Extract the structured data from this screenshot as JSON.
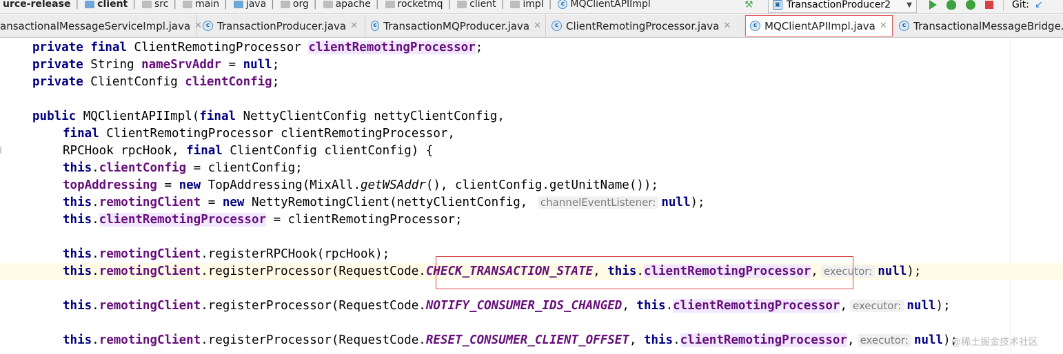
{
  "breadcrumb": {
    "items": [
      {
        "label": "urce-release",
        "icon": "none",
        "bold": true
      },
      {
        "label": "client",
        "icon": "module-folder-icon",
        "bold": true
      },
      {
        "label": "src",
        "icon": "folder-icon"
      },
      {
        "label": "main",
        "icon": "folder-icon"
      },
      {
        "label": "java",
        "icon": "source-folder-icon"
      },
      {
        "label": "org",
        "icon": "package-icon"
      },
      {
        "label": "apache",
        "icon": "package-icon"
      },
      {
        "label": "rocketmq",
        "icon": "package-icon"
      },
      {
        "label": "client",
        "icon": "package-icon"
      },
      {
        "label": "impl",
        "icon": "package-icon"
      },
      {
        "label": "MQClientAPIImpl",
        "icon": "class-icon"
      }
    ]
  },
  "toolbar": {
    "run_config": "TransactionProducer2",
    "git_label": "Git:"
  },
  "tabs": [
    {
      "label": "ansactionalMessageServiceImpl.java",
      "active": false
    },
    {
      "label": "TransactionProducer.java",
      "active": false
    },
    {
      "label": "TransactionMQProducer.java",
      "active": false
    },
    {
      "label": "ClientRemotingProcessor.java",
      "active": false
    },
    {
      "label": "MQClientAPIImpl.java",
      "active": true
    },
    {
      "label": "TransactionalMessageBridge.java",
      "active": false
    }
  ],
  "code": {
    "l1": {
      "kw1": "private",
      "kw2": "final",
      "type": " ClientRemotingProcessor ",
      "field": "clientRemotingProcessor",
      "end": ";"
    },
    "l2": {
      "kw1": "private",
      "type": " String ",
      "field": "nameSrvAddr",
      "eq": " = ",
      "nul": "null",
      "end": ";"
    },
    "l3": {
      "kw1": "private",
      "type": " ClientConfig ",
      "field": "clientConfig",
      "end": ";"
    },
    "l5": {
      "kw1": "public",
      "sig": " MQClientAPIImpl(",
      "kw2": "final",
      "rest": " NettyClientConfig nettyClientConfig,"
    },
    "l6": {
      "kw1": "final",
      "rest": " ClientRemotingProcessor clientRemotingProcessor,"
    },
    "l7": {
      "pre": "RPCHook rpcHook, ",
      "kw1": "final",
      "rest": " ClientConfig clientConfig) {"
    },
    "l8": {
      "kw": "this",
      "dot": ".",
      "field": "clientConfig",
      "rest": " = clientConfig;"
    },
    "l9": {
      "field": "topAddressing",
      "eq": " = ",
      "kw": "new",
      "mid": " TopAddressing(MixAll.",
      "method": "getWSAddr",
      "rest": "(), clientConfig.getUnitName());"
    },
    "l10": {
      "kw": "this",
      "dot": ".",
      "field": "remotingClient",
      "eq": " = ",
      "kw2": "new",
      "mid": " NettyRemotingClient(nettyClientConfig, ",
      "hint": "channelEventListener:",
      "nul": "null",
      "end": ");"
    },
    "l11": {
      "kw": "this",
      "dot": ".",
      "field": "clientRemotingProcessor",
      "rest": " = clientRemotingProcessor;"
    },
    "l13": {
      "kw": "this",
      "dot": ".",
      "field": "remotingClient",
      "rest": ".registerRPCHook(rpcHook);"
    },
    "l14": {
      "kw": "this",
      "dot": ".",
      "field": "remotingClient",
      "mid": ".registerProcessor(RequestCode.",
      "const": "CHECK_TRANSACTION_STATE",
      "comma": ", ",
      "kw2": "this",
      "dot2": ".",
      "field2": "clientRemotingProcessor",
      "comma2": ",",
      "hint": "executor:",
      "nul": "null",
      "end": ");"
    },
    "l16": {
      "kw": "this",
      "dot": ".",
      "field": "remotingClient",
      "mid": ".registerProcessor(RequestCode.",
      "const": "NOTIFY_CONSUMER_IDS_CHANGED",
      "comma": ", ",
      "kw2": "this",
      "dot2": ".",
      "field2": "clientRemotingProcessor",
      "comma2": ",",
      "hint": "executor:",
      "nul": "null",
      "end": ");"
    },
    "l18": {
      "kw": "this",
      "dot": ".",
      "field": "remotingClient",
      "mid": ".registerProcessor(RequestCode.",
      "const": "RESET_CONSUMER_CLIENT_OFFSET",
      "comma": ", ",
      "kw2": "this",
      "dot2": ".",
      "field2": "clientRemotingProcessor",
      "comma2": ",",
      "hint": "executor:",
      "nul": "null",
      "end": ");"
    }
  },
  "watermark": "@稀土掘金技术社区",
  "colors": {
    "keyword": "#000080",
    "field": "#660e7a",
    "highlight_line": "#fffbe6",
    "annotation_box": "#d94040"
  }
}
